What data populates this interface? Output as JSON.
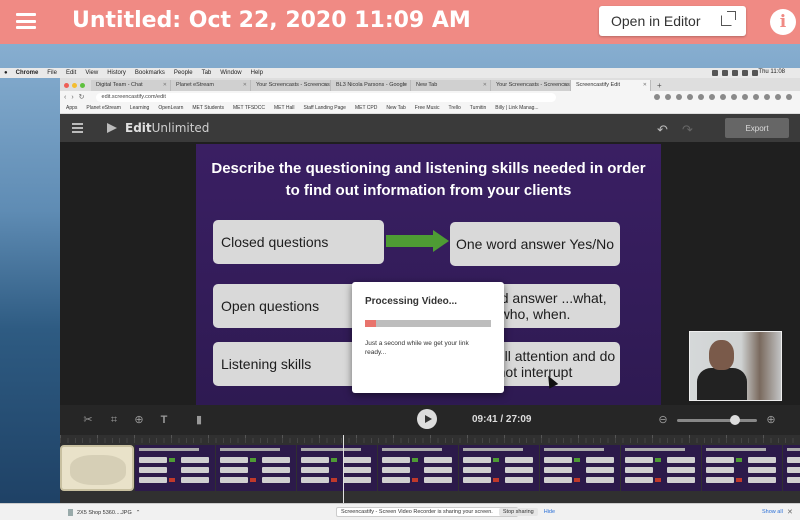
{
  "viewer": {
    "title": "Untitled: Oct 22, 2020 11:09 AM",
    "open_in_editor": "Open in Editor",
    "info_icon": "i"
  },
  "mac_menubar": {
    "items": [
      "Chrome",
      "File",
      "Edit",
      "View",
      "History",
      "Bookmarks",
      "People",
      "Tab",
      "Window",
      "Help"
    ],
    "clock": "Thu 11:08"
  },
  "browser": {
    "tabs": [
      "Digital Team - Chat",
      "Planet eStream",
      "Your Screencasts - Screencas",
      "BL3 Nicola Parsons - Google",
      "New Tab",
      "Your Screencasts - Screencas",
      "Screencastify Edit"
    ],
    "url": "edit.screencastify.com/edit",
    "bookmarks": [
      "Apps",
      "Planet eStream",
      "Learning",
      "OpenLearn",
      "MET Students",
      "MET TFSDCC",
      "MET Hall",
      "Staff Landing Page",
      "MET CPD",
      "New Tab",
      "Free Music",
      "Trello",
      "Turnitin",
      "Billy | Link Manag..."
    ]
  },
  "app": {
    "logo_bold": "Edit",
    "logo_rest": "Unlimited",
    "export_label": "Export",
    "undo_icon": "↶",
    "redo_icon": "↷"
  },
  "slide": {
    "heading": "Describe the questioning and listening skills needed in order to find out information from your clients",
    "left_items": [
      "Closed questions",
      "Open questions",
      "Listening skills"
    ],
    "right_items": [
      "One word answer Yes/No",
      "...tailed answer ...what, who, when.",
      "...pay full attention and do not interrupt"
    ]
  },
  "dialog": {
    "title": "Processing Video...",
    "progress": 0.09,
    "message": "Just a second while we get your link ready..."
  },
  "playback": {
    "timecode": "09:41 / 27:09",
    "zoom_level": 0.73
  },
  "downloads": {
    "file": "2X5 Shop 5360....JPG",
    "share_message": "Screencastify - Screen Video Recorder is sharing your screen.",
    "stop_sharing": "Stop sharing",
    "hide": "Hide",
    "show_all": "Show all"
  },
  "colors": {
    "viewer_bar": "#f08a84",
    "progress_fill": "#e8736c",
    "fab": "#2f7fc1",
    "slide_bg": "#3a1f63"
  }
}
